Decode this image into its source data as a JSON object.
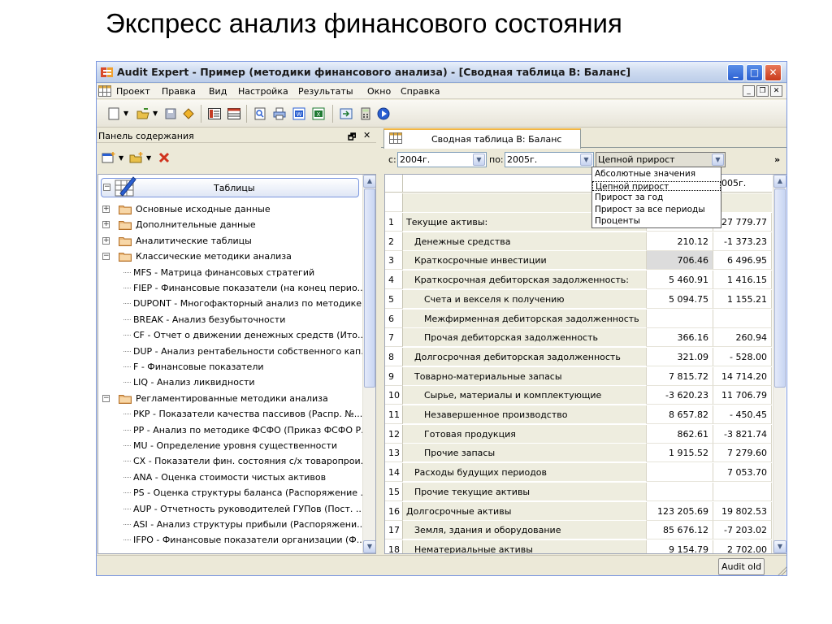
{
  "slide": {
    "title": "Экспресс анализ финансового состояния"
  },
  "window": {
    "title": "Audit Expert - Пример (методики финансового анализа)  - [Сводная таблица В: Баланс]",
    "controls": {
      "minimize": "_",
      "maximize": "□",
      "close": "✕"
    },
    "mdi_controls": {
      "minimize": "_",
      "restore": "❐",
      "close": "✕"
    }
  },
  "menu": {
    "items": [
      "Проект",
      "Правка",
      "Вид",
      "Настройка",
      "Результаты",
      "Окно",
      "Справка"
    ]
  },
  "toolbar": {
    "icons": [
      "new-document-icon",
      "open-folder-icon",
      "save-icon",
      "wizard-icon",
      "list-view-icon",
      "table-view-icon",
      "preview-icon",
      "print-icon",
      "word-export-icon",
      "excel-export-icon",
      "import-icon",
      "calculator-icon",
      "run-icon"
    ]
  },
  "left_panel": {
    "header": "Панель содержания",
    "pin": "🗗",
    "close": "✕",
    "tree_root": "Таблицы",
    "tree": [
      {
        "label": "Основные исходные данные",
        "level": 0,
        "type": "folder",
        "expander": "+"
      },
      {
        "label": "Дополнительные данные",
        "level": 0,
        "type": "folder",
        "expander": "+"
      },
      {
        "label": "Аналитические таблицы",
        "level": 0,
        "type": "folder",
        "expander": "+"
      },
      {
        "label": "Классические методики анализа",
        "level": 0,
        "type": "folder",
        "expander": "−"
      },
      {
        "label": "MFS - Матрица финансовых стратегий",
        "level": 1
      },
      {
        "label": "FIEP - Финансовые показатели (на конец перио...",
        "level": 1
      },
      {
        "label": "DUPONT - Многофакторный анализ по методике...",
        "level": 1
      },
      {
        "label": "BREAK - Анализ безубыточности",
        "level": 1
      },
      {
        "label": "CF - Отчет о движении денежных средств (Ито...",
        "level": 1
      },
      {
        "label": "DUP - Анализ рентабельности собственного кап...",
        "level": 1
      },
      {
        "label": "F - Финансовые показатели",
        "level": 1
      },
      {
        "label": "LIQ - Анализ ликвидности",
        "level": 1
      },
      {
        "label": "Регламентированные методики анализа",
        "level": 0,
        "type": "folder",
        "expander": "−"
      },
      {
        "label": "PKP - Показатели качества пассивов (Распр. №...",
        "level": 1
      },
      {
        "label": "PP - Анализ по методике ФСФО (Приказ ФСФО Р...",
        "level": 1
      },
      {
        "label": "MU - Определение уровня существенности",
        "level": 1
      },
      {
        "label": "CX - Показатели фин. состояния с/х товаропрои...",
        "level": 1
      },
      {
        "label": "ANA - Оценка стоимости чистых активов",
        "level": 1
      },
      {
        "label": "PS - Оценка структуры баланса (Распоряжение ...",
        "level": 1
      },
      {
        "label": "AUP - Отчетность руководителей ГУПов (Пост. ...",
        "level": 1
      },
      {
        "label": "ASI - Анализ структуры прибыли (Распоряжени...",
        "level": 1
      },
      {
        "label": "IFPO - Финансовые показатели организации (Ф...",
        "level": 1
      }
    ]
  },
  "right_panel": {
    "tab": "Сводная таблица В: Баланс",
    "filter": {
      "from_label": "с:",
      "from_value": "2004г.",
      "to_label": "по:",
      "to_value": "2005г.",
      "method_value": "Цепной прирост",
      "more": "»"
    },
    "dropdown_options": [
      "Абсолютные значения",
      "Цепной прирост",
      "Прирост за год",
      "Прирост за все периоды",
      "Проценты"
    ],
    "dropdown_selected_index": 1,
    "column_header": "2005г.",
    "rows": [
      {
        "n": "1",
        "name": "Текущие активы:",
        "indent": 0,
        "v1": "",
        "v2": "27 779.77"
      },
      {
        "n": "2",
        "name": "Денежные средства",
        "indent": 1,
        "v1": "210.12",
        "v2": "-1 373.23"
      },
      {
        "n": "3",
        "name": "Краткосрочные инвестиции",
        "indent": 1,
        "v1": "706.46",
        "v2": "6 496.95",
        "v1_selected": true
      },
      {
        "n": "4",
        "name": "Краткосрочная дебиторская задолженность:",
        "indent": 1,
        "v1": "5 460.91",
        "v2": "1 416.15"
      },
      {
        "n": "5",
        "name": "Счета и векселя к получению",
        "indent": 2,
        "v1": "5 094.75",
        "v2": "1 155.21"
      },
      {
        "n": "6",
        "name": "Межфирменная дебиторская задолженность",
        "indent": 2,
        "v1": "",
        "v2": ""
      },
      {
        "n": "7",
        "name": "Прочая дебиторская задолженность",
        "indent": 2,
        "v1": "366.16",
        "v2": "260.94"
      },
      {
        "n": "8",
        "name": "Долгосрочная дебиторская задолженность",
        "indent": 1,
        "v1": "321.09",
        "v2": "- 528.00"
      },
      {
        "n": "9",
        "name": "Товарно-материальные запасы",
        "indent": 1,
        "v1": "7 815.72",
        "v2": "14 714.20"
      },
      {
        "n": "10",
        "name": "Сырье, материалы и комплектующие",
        "indent": 2,
        "v1": "-3 620.23",
        "v2": "11 706.79"
      },
      {
        "n": "11",
        "name": "Незавершенное производство",
        "indent": 2,
        "v1": "8 657.82",
        "v2": "- 450.45"
      },
      {
        "n": "12",
        "name": "Готовая продукция",
        "indent": 2,
        "v1": "862.61",
        "v2": "-3 821.74"
      },
      {
        "n": "13",
        "name": "Прочие запасы",
        "indent": 2,
        "v1": "1 915.52",
        "v2": "7 279.60"
      },
      {
        "n": "14",
        "name": "Расходы будущих периодов",
        "indent": 1,
        "v1": "",
        "v2": "7 053.70"
      },
      {
        "n": "15",
        "name": "Прочие текущие активы",
        "indent": 1,
        "v1": "",
        "v2": ""
      },
      {
        "n": "16",
        "name": "Долгосрочные активы",
        "indent": 0,
        "v1": "123 205.69",
        "v2": "19 802.53"
      },
      {
        "n": "17",
        "name": "Земля, здания и оборудование",
        "indent": 1,
        "v1": "85 676.12",
        "v2": "-7 203.02"
      },
      {
        "n": "18",
        "name": "Нематериальные активы",
        "indent": 1,
        "v1": "9 154.79",
        "v2": "2 702.00"
      }
    ]
  },
  "status": {
    "button": "Audit old"
  },
  "colors": {
    "title_bar": "#cfdcf0",
    "panel": "#ece9d8",
    "name_column": "#eeeddf",
    "selection": "#dcdcdc",
    "tab_accent": "#f2b643"
  }
}
